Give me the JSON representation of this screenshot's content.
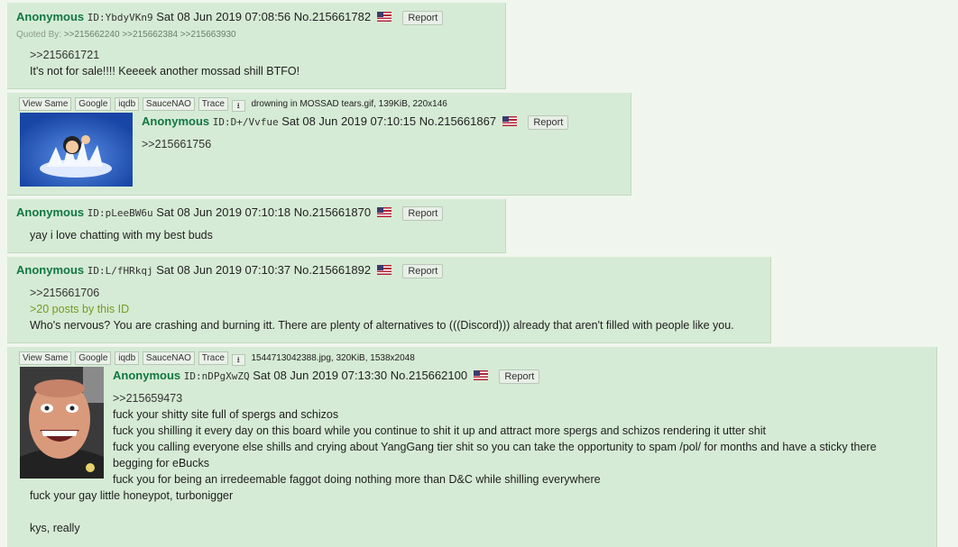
{
  "common": {
    "name": "Anonymous",
    "report_label": "Report"
  },
  "posts": [
    {
      "id": "ID:YbdyVKn9",
      "date": "Sat 08 Jun 2019 07:08:56",
      "no": "No.215661782",
      "quoted_by": {
        "label": "Quoted By:",
        "links": [
          ">>215662240",
          ">>215662384",
          ">>215663930"
        ]
      },
      "lines": [
        ">>215661721",
        "It's not for sale!!!! Keeeek another mossad shill BTFO!"
      ]
    },
    {
      "file": {
        "buttons": [
          "View Same",
          "Google",
          "iqdb",
          "SauceNAO",
          "Trace"
        ],
        "download_icon": "download-icon",
        "name": "drowning in MOSSAD tears.gif",
        "info": ", 139KiB, 220x146"
      },
      "id": "ID:D+/Vvfue",
      "date": "Sat 08 Jun 2019 07:10:15",
      "no": "No.215661867",
      "lines": [
        ">>215661756"
      ]
    },
    {
      "id": "ID:pLeeBW6u",
      "date": "Sat 08 Jun 2019 07:10:18",
      "no": "No.215661870",
      "lines": [
        "yay i love chatting with my best buds"
      ]
    },
    {
      "id": "ID:L/fHRkqj",
      "date": "Sat 08 Jun 2019 07:10:37",
      "no": "No.215661892",
      "lines": [
        ">>215661706",
        ">20 posts by this ID",
        "Who's nervous? You are crashing and burning itt. There are plenty of alternatives to (((Discord))) already that aren't filled with people like you."
      ]
    },
    {
      "file": {
        "buttons": [
          "View Same",
          "Google",
          "iqdb",
          "SauceNAO",
          "Trace"
        ],
        "download_icon": "download-icon",
        "name": "1544713042388.jpg",
        "info": ", 320KiB, 1538x2048"
      },
      "id": "ID:nDPgXwZQ",
      "date": "Sat 08 Jun 2019 07:13:30",
      "no": "No.215662100",
      "lines": [
        ">>215659473",
        "fuck your shitty site full of spergs and schizos",
        "fuck you shilling it every day on this board while you continue to shit it up and attract more spergs and schizos rendering it utter shit",
        "fuck you calling everyone else shills and crying about YangGang tier shit so you can take the opportunity to spam /pol/ for months and have a sticky there",
        "begging for eBucks",
        "fuck you for being an irredeemable faggot doing nothing more than D&C while shilling everywhere",
        "fuck your gay little honeypot, turbonigger",
        "",
        "kys, really"
      ]
    }
  ]
}
